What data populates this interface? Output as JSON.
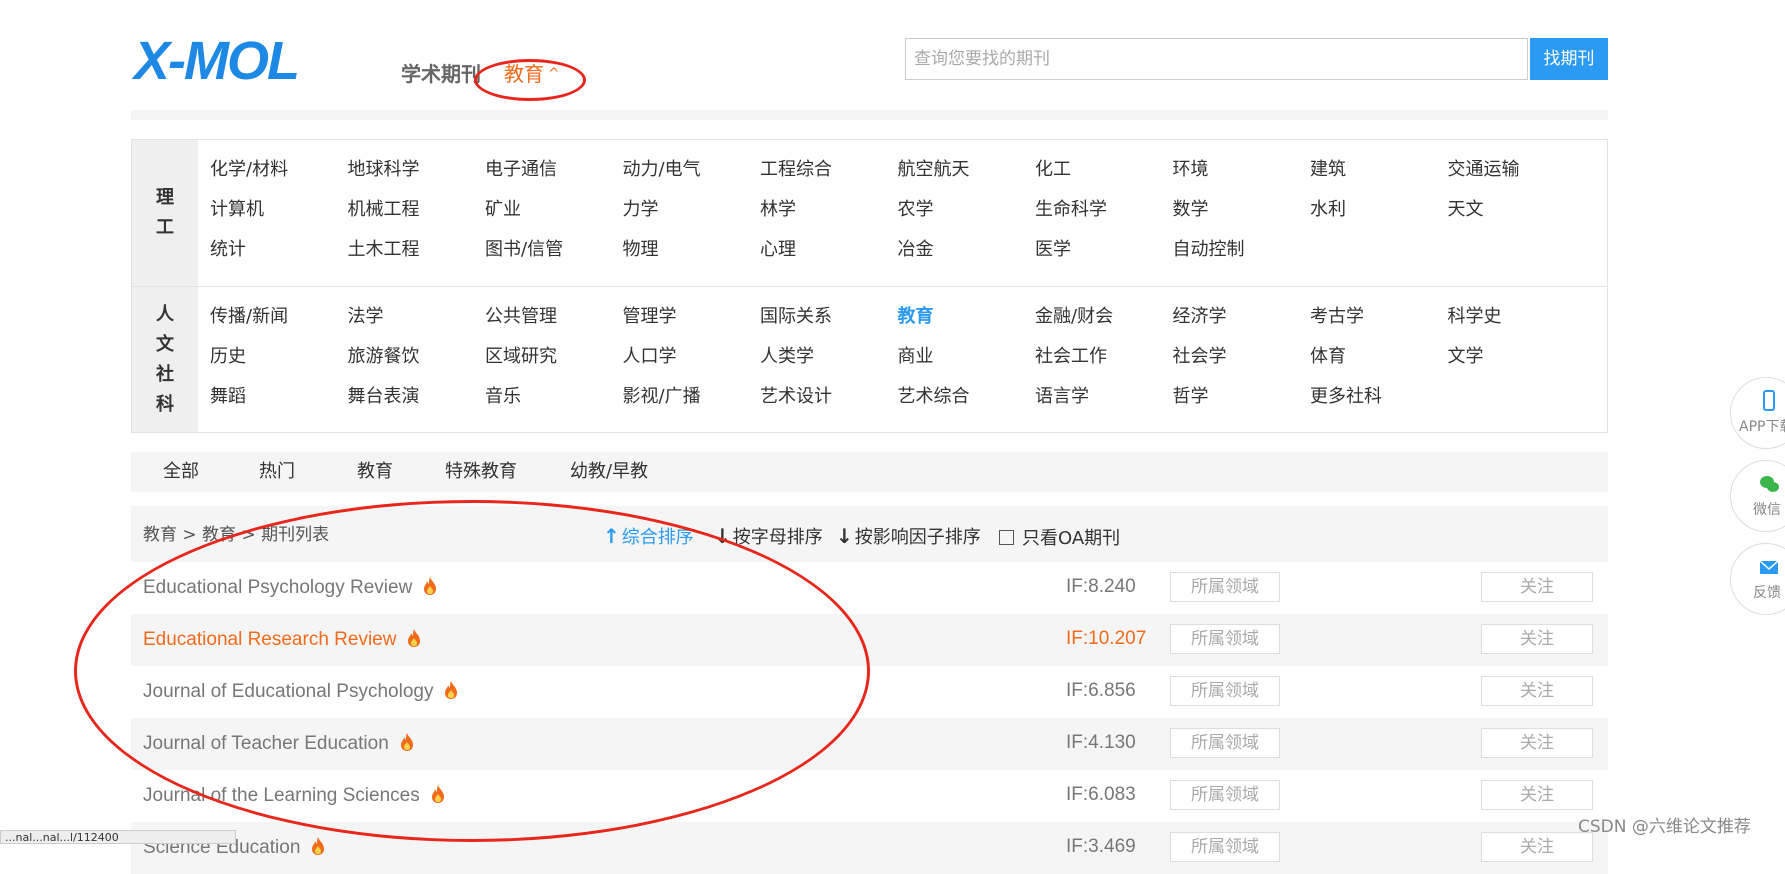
{
  "header": {
    "logo_text": "X-MOL",
    "logo_subtitle": "学术期刊",
    "current_category": "教育",
    "search_placeholder": "查询您要找的期刊",
    "search_button": "找期刊"
  },
  "categories": {
    "group1": {
      "label": "理工",
      "items": [
        "化学/材料",
        "地球科学",
        "电子通信",
        "动力/电气",
        "工程综合",
        "航空航天",
        "化工",
        "环境",
        "建筑",
        "交通运输",
        "计算机",
        "机械工程",
        "矿业",
        "力学",
        "林学",
        "农学",
        "生命科学",
        "数学",
        "水利",
        "天文",
        "统计",
        "土木工程",
        "图书/信管",
        "物理",
        "心理",
        "冶金",
        "医学",
        "自动控制"
      ]
    },
    "group2": {
      "label": "人文社科",
      "items": [
        "传播/新闻",
        "法学",
        "公共管理",
        "管理学",
        "国际关系",
        "教育",
        "金融/财会",
        "经济学",
        "考古学",
        "科学史",
        "历史",
        "旅游餐饮",
        "区域研究",
        "人口学",
        "人类学",
        "商业",
        "社会工作",
        "社会学",
        "体育",
        "文学",
        "舞蹈",
        "舞台表演",
        "音乐",
        "影视/广播",
        "艺术设计",
        "艺术综合",
        "语言学",
        "哲学",
        "更多社科"
      ],
      "active": "教育"
    }
  },
  "tabs": [
    "全部",
    "热门",
    "教育",
    "特殊教育",
    "幼教/早教"
  ],
  "breadcrumb": "教育 > 教育 > 期刊列表",
  "sort": {
    "options": [
      {
        "arrow": "↑",
        "label": "综合排序",
        "active": true
      },
      {
        "arrow": "↓",
        "label": "按字母排序",
        "active": false
      },
      {
        "arrow": "↓",
        "label": "按影响因子排序",
        "active": false
      }
    ],
    "oa_label": "只看OA期刊"
  },
  "journals": [
    {
      "name": "Educational Psychology Review",
      "if": "IF:8.240",
      "field": "所属领域",
      "follow": "关注",
      "highlight": false
    },
    {
      "name": "Educational Research Review",
      "if": "IF:10.207",
      "field": "所属领域",
      "follow": "关注",
      "highlight": true
    },
    {
      "name": "Journal of Educational Psychology",
      "if": "IF:6.856",
      "field": "所属领域",
      "follow": "关注",
      "highlight": false
    },
    {
      "name": "Journal of Teacher Education",
      "if": "IF:4.130",
      "field": "所属领域",
      "follow": "关注",
      "highlight": false
    },
    {
      "name": "Journal of the Learning Sciences",
      "if": "IF:6.083",
      "field": "所属领域",
      "follow": "关注",
      "highlight": false
    },
    {
      "name": "Science Education",
      "if": "IF:3.469",
      "field": "所属领域",
      "follow": "关注",
      "highlight": false
    }
  ],
  "float_buttons": [
    {
      "label": "APP下载",
      "icon": "phone-icon"
    },
    {
      "label": "微信",
      "icon": "wechat-icon"
    },
    {
      "label": "反馈",
      "icon": "mail-icon"
    }
  ],
  "status_url": "...nal...nal...l/112400",
  "watermark": "CSDN @六维论文推荐",
  "colors": {
    "brand_blue": "#1e88e5",
    "accent_orange": "#f26b1d",
    "link_blue": "#2b9af3",
    "annotation_red": "#e8261c"
  }
}
